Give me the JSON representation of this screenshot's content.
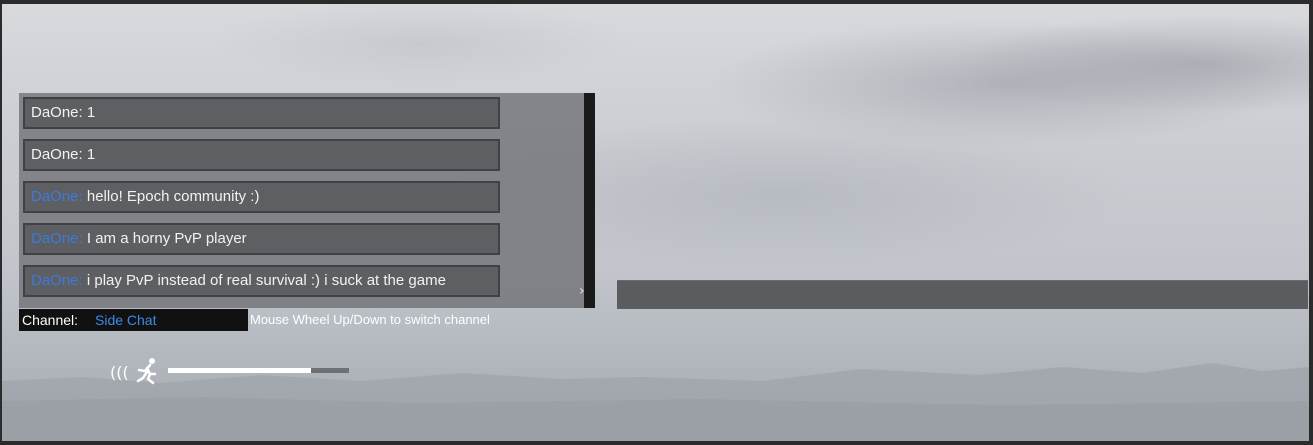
{
  "chat": {
    "messages": [
      {
        "name": "DaOne:",
        "text": " 1",
        "name_color": "white"
      },
      {
        "name": "DaOne:",
        "text": " 1",
        "name_color": "white"
      },
      {
        "name": "DaOne:",
        "text": " hello! Epoch community :)",
        "name_color": "blue"
      },
      {
        "name": "DaOne:",
        "text": " I am a horny PvP player",
        "name_color": "blue"
      },
      {
        "name": "DaOne:",
        "text": " i play PvP instead of real survival :) i suck at the game",
        "name_color": "blue"
      }
    ],
    "scroll_arrow_icon": "chevron-right-icon"
  },
  "channel": {
    "label": "Channel:",
    "value": "Side Chat",
    "hint": "Mouse Wheel Up/Down to switch channel"
  },
  "hud": {
    "sound_icon": "sound-waves-icon",
    "run_icon": "running-man-icon",
    "stamina_fraction": 0.79
  },
  "colors": {
    "name_blue": "#3d7ad9",
    "channel_blue": "#3d8ae8"
  }
}
